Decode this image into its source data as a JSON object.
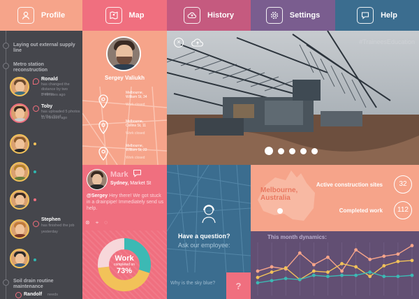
{
  "nav": {
    "tabs": [
      {
        "label": "Profile",
        "icon": "user-icon",
        "color": "#f6a48a"
      },
      {
        "label": "Map",
        "icon": "map-icon",
        "color": "#f06f7f"
      },
      {
        "label": "History",
        "icon": "cloud-upload-icon",
        "color": "#c55a7f"
      },
      {
        "label": "Settings",
        "icon": "gear-icon",
        "color": "#7a5d8f"
      },
      {
        "label": "Help",
        "icon": "chat-icon",
        "color": "#3b6d8f"
      }
    ]
  },
  "sidebar": {
    "section1": "Laying out external supply line",
    "section2": "Metro station reconstruction",
    "feed": [
      {
        "name": "Ronald",
        "action": "has changed the distance by two meters",
        "time": "3 minutes ago"
      },
      {
        "name": "Toby",
        "action": "has uploaded 5 photos to the cloud",
        "time": "11 minutes ago"
      },
      {
        "name": "Stephen",
        "action": "has finished the job",
        "time": "yesterday"
      }
    ],
    "section3": "Soil drain routine maintenance",
    "last_name": "Randolf",
    "last_action": "needs"
  },
  "profile": {
    "name": "Sergey Valiukh",
    "places": [
      {
        "city": "Melbourne,",
        "street": "William St, 34",
        "status": "Work closed"
      },
      {
        "city": "Melbourne,",
        "street": "Collins St, 11",
        "status": "Work closed"
      },
      {
        "city": "Melbourne,",
        "street": "William St, 22",
        "status": "Work closed"
      }
    ]
  },
  "message": {
    "name": "Mark",
    "city": "Sydney,",
    "street": "Market St",
    "mention": "@Sergey",
    "body": "Hey there! We got stuck in a drainpipe! Immediately send us help."
  },
  "donut": {
    "title": "Work",
    "subtitle": "completed on",
    "percent": "73%",
    "segments": [
      {
        "color": "#3cb9b4",
        "value": 0.3
      },
      {
        "color": "#f2c259",
        "value": 0.43
      },
      {
        "color": "#f7d7da",
        "value": 0.27
      }
    ]
  },
  "photo": {
    "hashtag": "#TraineesEducation",
    "slides": 5,
    "active_slide": 0
  },
  "help": {
    "title": "Have a question?",
    "subtitle": "Ask our employee:",
    "faq": "Why is the sky blue?",
    "faq_button": "?"
  },
  "stats": {
    "city": "Melbourne,",
    "country": "Australia",
    "active_label": "Active construction sites",
    "active_value": "32",
    "completed_label": "Completed work",
    "completed_value": "112"
  },
  "chart_data": {
    "type": "line",
    "title": "This month dynamics:",
    "x": [
      1,
      2,
      3,
      4,
      5,
      6,
      7,
      8,
      9,
      10,
      11,
      12
    ],
    "ylim": [
      0,
      10
    ],
    "grid": true,
    "series": [
      {
        "color": "#f6a48a",
        "values": [
          4.6,
          5.4,
          5.0,
          8.0,
          5.8,
          7.2,
          4.6,
          8.6,
          6.8,
          7.4,
          7.8,
          9.4
        ]
      },
      {
        "color": "#f2c259",
        "values": [
          3.4,
          4.4,
          5.2,
          3.0,
          4.6,
          4.4,
          6.0,
          5.4,
          3.6,
          5.6,
          6.4,
          6.6
        ]
      },
      {
        "color": "#3cb9b4",
        "values": [
          2.4,
          2.8,
          3.2,
          3.0,
          3.8,
          3.6,
          3.8,
          3.8,
          4.4,
          3.6,
          3.6,
          3.8
        ]
      }
    ]
  }
}
